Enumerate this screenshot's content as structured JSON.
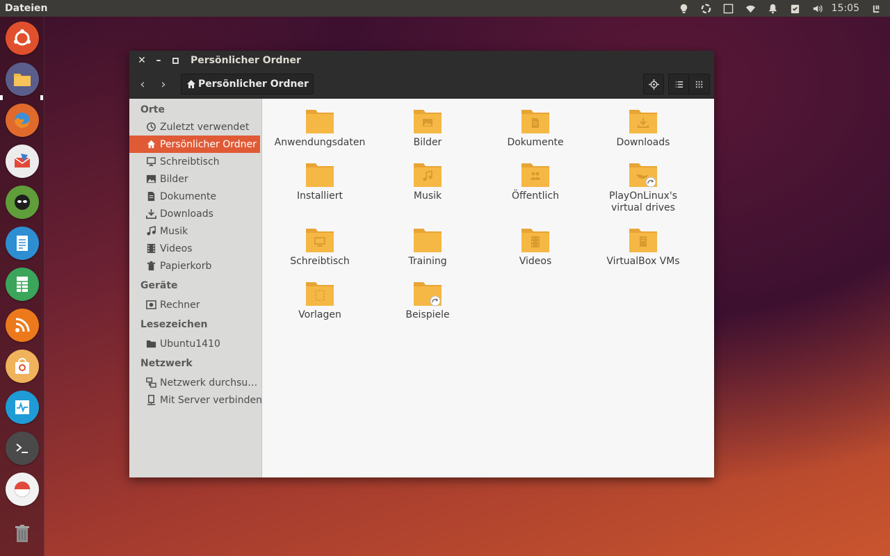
{
  "top_panel": {
    "app_name": "Dateien",
    "clock": "15:05"
  },
  "window": {
    "title": "Persönlicher Ordner",
    "path": "Persönlicher Ordner"
  },
  "sidebar": {
    "sections": [
      {
        "heading": "Orte",
        "items": [
          {
            "label": "Zuletzt verwendet",
            "icon": "clock-icon"
          },
          {
            "label": "Persönlicher Ordner",
            "icon": "home-icon",
            "active": true
          },
          {
            "label": "Schreibtisch",
            "icon": "desktop-icon"
          },
          {
            "label": "Bilder",
            "icon": "pictures-icon"
          },
          {
            "label": "Dokumente",
            "icon": "document-icon"
          },
          {
            "label": "Downloads",
            "icon": "download-icon"
          },
          {
            "label": "Musik",
            "icon": "music-icon"
          },
          {
            "label": "Videos",
            "icon": "video-icon"
          },
          {
            "label": "Papierkorb",
            "icon": "trash-icon"
          }
        ]
      },
      {
        "heading": "Geräte",
        "items": [
          {
            "label": "Rechner",
            "icon": "computer-icon"
          }
        ]
      },
      {
        "heading": "Lesezeichen",
        "items": [
          {
            "label": "Ubuntu1410",
            "icon": "folder-icon"
          }
        ]
      },
      {
        "heading": "Netzwerk",
        "items": [
          {
            "label": "Netzwerk durchsu…",
            "icon": "network-icon"
          },
          {
            "label": "Mit Server verbinden",
            "icon": "server-icon"
          }
        ]
      }
    ]
  },
  "files": [
    {
      "label": "Anwendungsdaten",
      "emblem": "none"
    },
    {
      "label": "Bilder",
      "emblem": "picture"
    },
    {
      "label": "Dokumente",
      "emblem": "document"
    },
    {
      "label": "Downloads",
      "emblem": "download"
    },
    {
      "label": "Installiert",
      "emblem": "none"
    },
    {
      "label": "Musik",
      "emblem": "music"
    },
    {
      "label": "Öffentlich",
      "emblem": "people"
    },
    {
      "label": "PlayOnLinux's\nvirtual drives",
      "emblem": "playonlinux"
    },
    {
      "label": "Schreibtisch",
      "emblem": "desktop"
    },
    {
      "label": "Training",
      "emblem": "none"
    },
    {
      "label": "Videos",
      "emblem": "video"
    },
    {
      "label": "VirtualBox VMs",
      "emblem": "vbox"
    },
    {
      "label": "Vorlagen",
      "emblem": "template"
    },
    {
      "label": "Beispiele",
      "emblem": "link"
    }
  ],
  "colors": {
    "accent": "#e05a36",
    "folder": "#f5b844"
  }
}
